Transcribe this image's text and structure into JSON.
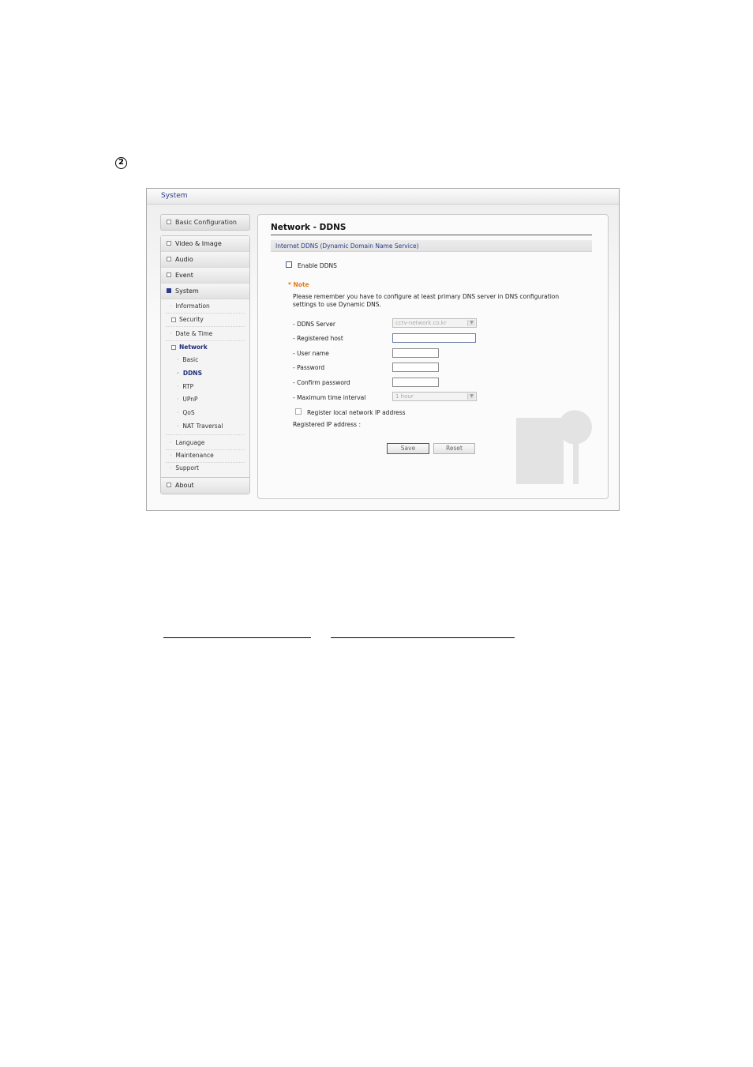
{
  "step_marker": "2",
  "window": {
    "title": "System"
  },
  "sidebar": {
    "basic_configuration": "Basic Configuration",
    "groups": [
      {
        "label": "Video & Image"
      },
      {
        "label": "Audio"
      },
      {
        "label": "Event"
      },
      {
        "label": "System",
        "expanded": true
      }
    ],
    "system_items": {
      "information": "Information",
      "security": "Security",
      "date_time": "Date & Time",
      "network": "Network",
      "network_sub": [
        "Basic",
        "DDNS",
        "RTP",
        "UPnP",
        "QoS",
        "NAT Traversal"
      ],
      "language": "Language",
      "maintenance": "Maintenance",
      "support": "Support"
    },
    "about": "About",
    "active_item": "DDNS"
  },
  "content": {
    "title": "Network - DDNS",
    "section": "Internet DDNS (Dynamic Domain Name Service)",
    "enable_ddns": {
      "label": "Enable DDNS",
      "checked": false
    },
    "note_label": "* Note",
    "note_text": "Please remember you have to configure at least primary DNS server in DNS configuration settings to use Dynamic DNS.",
    "fields": {
      "ddns_server": {
        "label": "- DDNS Server",
        "value": "cctv-network.co.kr"
      },
      "registered_host": {
        "label": "- Registered host",
        "value": ""
      },
      "user_name": {
        "label": "- User name",
        "value": ""
      },
      "password": {
        "label": "- Password",
        "value": ""
      },
      "confirm_password": {
        "label": "- Confirm password",
        "value": ""
      },
      "max_interval": {
        "label": "- Maximum time interval",
        "value": "1 hour"
      }
    },
    "register_local": {
      "label": "Register local network IP address",
      "checked": false
    },
    "registered_ip": "Registered IP address :",
    "save_label": "Save",
    "reset_label": "Reset"
  },
  "colors": {
    "accent": "#2b3a8a",
    "note": "#e07b1d"
  }
}
